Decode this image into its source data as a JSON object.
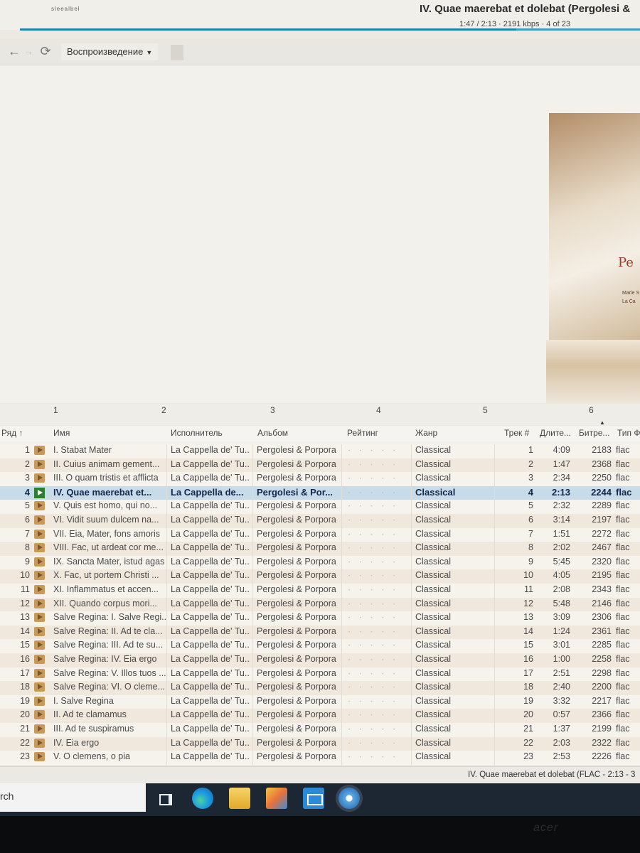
{
  "window": {
    "app_logo": "sleealbel",
    "now_playing_title": "IV. Quae maerebat et dolebat (Pergolesi &",
    "now_playing_info": "1:47 / 2:13 · 2191 kbps · 4 of 23",
    "progress": 0.8
  },
  "toolbar": {
    "back_icon": "arrow-left-icon",
    "forward_icon": "arrow-right-icon",
    "refresh_icon": "refresh-icon",
    "menu_label": "Воспроизведение"
  },
  "cover_art": {
    "title_fragment": "Pe",
    "line1": "Marie S",
    "line2": "La Ca"
  },
  "column_numbers": [
    "1",
    "2",
    "3",
    "4",
    "5",
    "6"
  ],
  "columns": {
    "row": "Ряд ↑",
    "name": "Имя",
    "artist": "Исполнитель",
    "album": "Альбом",
    "rating": "Рейтинг",
    "genre": "Жанр",
    "track": "Трек #",
    "duration": "Длите...",
    "bitrate": "Битре...",
    "type": "Тип Ф"
  },
  "tracks": [
    {
      "num": "1",
      "name": "I. Stabat Mater",
      "artist": "La Cappella de' Tu...",
      "album": "Pergolesi & Porpora",
      "genre": "Classical",
      "track": "1",
      "duration": "4:09",
      "bitrate": "2183",
      "type": "flac"
    },
    {
      "num": "2",
      "name": "II. Cuius animam gement...",
      "artist": "La Cappella de' Tu...",
      "album": "Pergolesi & Porpora",
      "genre": "Classical",
      "track": "2",
      "duration": "1:47",
      "bitrate": "2368",
      "type": "flac"
    },
    {
      "num": "3",
      "name": "III. O quam tristis et afflicta",
      "artist": "La Cappella de' Tu...",
      "album": "Pergolesi & Porpora",
      "genre": "Classical",
      "track": "3",
      "duration": "2:34",
      "bitrate": "2250",
      "type": "flac"
    },
    {
      "num": "4",
      "name": "IV. Quae maerebat et...",
      "artist": "La Cappella de...",
      "album": "Pergolesi & Por...",
      "genre": "Classical",
      "track": "4",
      "duration": "2:13",
      "bitrate": "2244",
      "type": "flac",
      "playing": true
    },
    {
      "num": "5",
      "name": "V. Quis est homo, qui no...",
      "artist": "La Cappella de' Tu...",
      "album": "Pergolesi & Porpora",
      "genre": "Classical",
      "track": "5",
      "duration": "2:32",
      "bitrate": "2289",
      "type": "flac"
    },
    {
      "num": "6",
      "name": "VI. Vidit suum dulcem na...",
      "artist": "La Cappella de' Tu...",
      "album": "Pergolesi & Porpora",
      "genre": "Classical",
      "track": "6",
      "duration": "3:14",
      "bitrate": "2197",
      "type": "flac"
    },
    {
      "num": "7",
      "name": "VII. Eia, Mater, fons amoris",
      "artist": "La Cappella de' Tu...",
      "album": "Pergolesi & Porpora",
      "genre": "Classical",
      "track": "7",
      "duration": "1:51",
      "bitrate": "2272",
      "type": "flac"
    },
    {
      "num": "8",
      "name": "VIII. Fac, ut ardeat cor me...",
      "artist": "La Cappella de' Tu...",
      "album": "Pergolesi & Porpora",
      "genre": "Classical",
      "track": "8",
      "duration": "2:02",
      "bitrate": "2467",
      "type": "flac"
    },
    {
      "num": "9",
      "name": "IX. Sancta Mater, istud agas",
      "artist": "La Cappella de' Tu...",
      "album": "Pergolesi & Porpora",
      "genre": "Classical",
      "track": "9",
      "duration": "5:45",
      "bitrate": "2320",
      "type": "flac"
    },
    {
      "num": "10",
      "name": "X. Fac, ut portem Christi ...",
      "artist": "La Cappella de' Tu...",
      "album": "Pergolesi & Porpora",
      "genre": "Classical",
      "track": "10",
      "duration": "4:05",
      "bitrate": "2195",
      "type": "flac"
    },
    {
      "num": "11",
      "name": "XI. Inflammatus et accen...",
      "artist": "La Cappella de' Tu...",
      "album": "Pergolesi & Porpora",
      "genre": "Classical",
      "track": "11",
      "duration": "2:08",
      "bitrate": "2343",
      "type": "flac"
    },
    {
      "num": "12",
      "name": "XII. Quando corpus mori...",
      "artist": "La Cappella de' Tu...",
      "album": "Pergolesi & Porpora",
      "genre": "Classical",
      "track": "12",
      "duration": "5:48",
      "bitrate": "2146",
      "type": "flac"
    },
    {
      "num": "13",
      "name": "Salve Regina: I. Salve Regi...",
      "artist": "La Cappella de' Tu...",
      "album": "Pergolesi & Porpora",
      "genre": "Classical",
      "track": "13",
      "duration": "3:09",
      "bitrate": "2306",
      "type": "flac"
    },
    {
      "num": "14",
      "name": "Salve Regina: II. Ad te cla...",
      "artist": "La Cappella de' Tu...",
      "album": "Pergolesi & Porpora",
      "genre": "Classical",
      "track": "14",
      "duration": "1:24",
      "bitrate": "2361",
      "type": "flac"
    },
    {
      "num": "15",
      "name": "Salve Regina: III. Ad te su...",
      "artist": "La Cappella de' Tu...",
      "album": "Pergolesi & Porpora",
      "genre": "Classical",
      "track": "15",
      "duration": "3:01",
      "bitrate": "2285",
      "type": "flac"
    },
    {
      "num": "16",
      "name": "Salve Regina: IV. Eia ergo",
      "artist": "La Cappella de' Tu...",
      "album": "Pergolesi & Porpora",
      "genre": "Classical",
      "track": "16",
      "duration": "1:00",
      "bitrate": "2258",
      "type": "flac"
    },
    {
      "num": "17",
      "name": "Salve Regina: V. Illos tuos ...",
      "artist": "La Cappella de' Tu...",
      "album": "Pergolesi & Porpora",
      "genre": "Classical",
      "track": "17",
      "duration": "2:51",
      "bitrate": "2298",
      "type": "flac"
    },
    {
      "num": "18",
      "name": "Salve Regina: VI. O cleme...",
      "artist": "La Cappella de' Tu...",
      "album": "Pergolesi & Porpora",
      "genre": "Classical",
      "track": "18",
      "duration": "2:40",
      "bitrate": "2200",
      "type": "flac"
    },
    {
      "num": "19",
      "name": "I. Salve Regina",
      "artist": "La Cappella de' Tu...",
      "album": "Pergolesi & Porpora",
      "genre": "Classical",
      "track": "19",
      "duration": "3:32",
      "bitrate": "2217",
      "type": "flac"
    },
    {
      "num": "20",
      "name": "II. Ad te clamamus",
      "artist": "La Cappella de' Tu...",
      "album": "Pergolesi & Porpora",
      "genre": "Classical",
      "track": "20",
      "duration": "0:57",
      "bitrate": "2366",
      "type": "flac"
    },
    {
      "num": "21",
      "name": "III. Ad te suspiramus",
      "artist": "La Cappella de' Tu...",
      "album": "Pergolesi & Porpora",
      "genre": "Classical",
      "track": "21",
      "duration": "1:37",
      "bitrate": "2199",
      "type": "flac"
    },
    {
      "num": "22",
      "name": "IV. Eia ergo",
      "artist": "La Cappella de' Tu...",
      "album": "Pergolesi & Porpora",
      "genre": "Classical",
      "track": "22",
      "duration": "2:03",
      "bitrate": "2322",
      "type": "flac"
    },
    {
      "num": "23",
      "name": "V. O clemens, o pia",
      "artist": "La Cappella de' Tu...",
      "album": "Pergolesi & Porpora",
      "genre": "Classical",
      "track": "23",
      "duration": "2:53",
      "bitrate": "2226",
      "type": "flac"
    }
  ],
  "rating_placeholder": "• • • • •",
  "status_bar": {
    "text": "IV. Quae maerebat et dolebat (FLAC - 2:13 - 3"
  },
  "taskbar": {
    "search_text": "rch",
    "icons": [
      "task-view-icon",
      "edge-icon",
      "file-explorer-icon",
      "store-icon",
      "mail-icon",
      "media-player-icon"
    ]
  },
  "monitor": {
    "brand": "acer"
  }
}
